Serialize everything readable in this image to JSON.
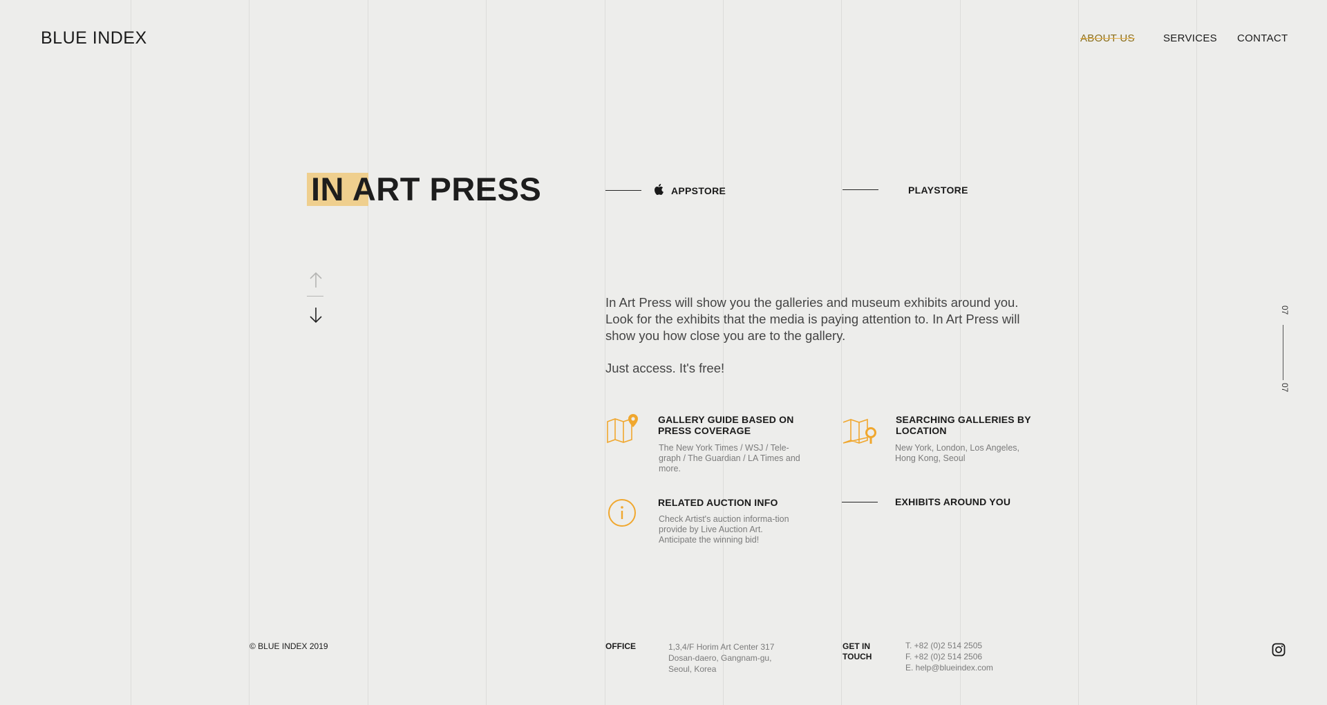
{
  "brand": {
    "logo": "BLUE INDEX"
  },
  "nav": {
    "items": [
      {
        "label": "ABOUT US",
        "active": true
      },
      {
        "label": "SERVICES",
        "active": false
      },
      {
        "label": "CONTACT",
        "active": false
      }
    ]
  },
  "hero": {
    "title": "IN ART PRESS",
    "appstore_label": "APPSTORE",
    "playstore_label": "PLAYSTORE"
  },
  "description": {
    "paragraph": "In Art Press will show you the galleries and museum exhibits around you. Look for the exhibits that the media is paying attention to. In Art Press will show you how close you are to the gallery.",
    "tagline": "Just access. It's free!"
  },
  "features": [
    {
      "icon": "map-pin-icon",
      "title": "GALLERY GUIDE BASED ON PRESS COVERAGE",
      "text": "The New York Times / WSJ / Tele-graph / The Guardian / LA Times and more."
    },
    {
      "icon": "map-search-icon",
      "title": "SEARCHING GALLERIES BY LOCATION",
      "text": "New York, London, Los Angeles, Hong Kong, Seoul"
    },
    {
      "icon": "info-circle-icon",
      "title": "RELATED AUCTION INFO",
      "text": "Check Artist's auction informa-tion provide by Live Auction Art. Anticipate the winning bid!"
    },
    {
      "icon": "line-divider",
      "title": "EXHIBITS AROUND YOU",
      "text": ""
    }
  ],
  "pager": {
    "current": "07",
    "total": "07"
  },
  "footer": {
    "copyright": "© BLUE INDEX 2019",
    "office_label": "OFFICE",
    "office_address": [
      "1,3,4/F Horim Art Center 317",
      "Dosan-daero, Gangnam-gu,",
      "Seoul, Korea"
    ],
    "contact_label": [
      "GET IN",
      "TOUCH"
    ],
    "contact_lines": [
      "T. +82 (0)2 514 2505",
      "F. +82 (0)2 514 2506",
      "E. help@blueindex.com"
    ]
  },
  "colors": {
    "accent": "#f0a72e",
    "highlight": "#efcf8e",
    "background": "#ededeb"
  }
}
